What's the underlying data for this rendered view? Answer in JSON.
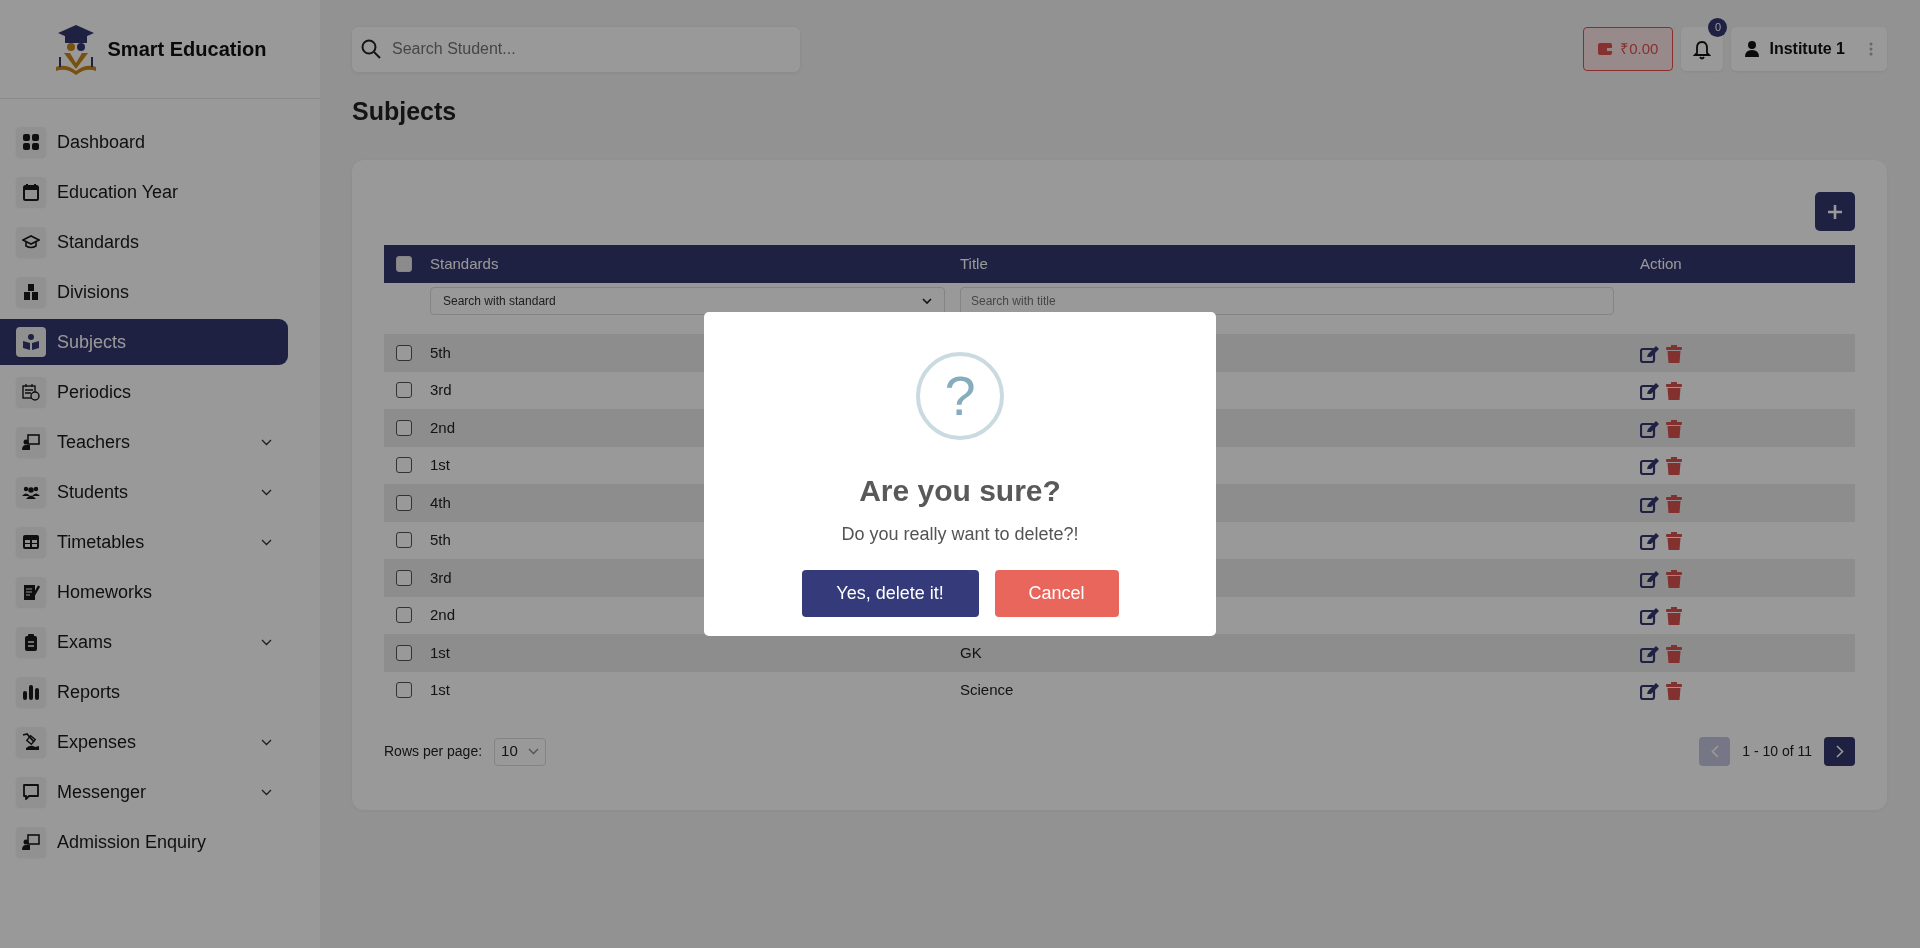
{
  "brand": {
    "name": "Smart Education"
  },
  "sidebar": {
    "items": [
      {
        "label": "Dashboard",
        "selected": false,
        "expandable": false
      },
      {
        "label": "Education Year",
        "selected": false,
        "expandable": false
      },
      {
        "label": "Standards",
        "selected": false,
        "expandable": false
      },
      {
        "label": "Divisions",
        "selected": false,
        "expandable": false
      },
      {
        "label": "Subjects",
        "selected": true,
        "expandable": false
      },
      {
        "label": "Periodics",
        "selected": false,
        "expandable": false
      },
      {
        "label": "Teachers",
        "selected": false,
        "expandable": true
      },
      {
        "label": "Students",
        "selected": false,
        "expandable": true
      },
      {
        "label": "Timetables",
        "selected": false,
        "expandable": true
      },
      {
        "label": "Homeworks",
        "selected": false,
        "expandable": false
      },
      {
        "label": "Exams",
        "selected": false,
        "expandable": true
      },
      {
        "label": "Reports",
        "selected": false,
        "expandable": false
      },
      {
        "label": "Expenses",
        "selected": false,
        "expandable": true
      },
      {
        "label": "Messenger",
        "selected": false,
        "expandable": true
      },
      {
        "label": "Admission Enquiry",
        "selected": false,
        "expandable": false
      }
    ]
  },
  "header": {
    "search": {
      "placeholder": "Search Student..."
    },
    "wallet": "₹0.00",
    "notifications": "0",
    "user": "Institute 1"
  },
  "page_title": "Subjects",
  "table": {
    "select_all": false,
    "columns": [
      "Standards",
      "Title",
      "Action"
    ],
    "filters": {
      "standard": "Search with standard",
      "title_placeholder": "Search with title"
    },
    "rows": [
      {
        "standard": "5th",
        "selected": false
      },
      {
        "standard": "3rd",
        "selected": false
      },
      {
        "standard": "2nd",
        "selected": false
      },
      {
        "standard": "1st",
        "selected": false
      },
      {
        "standard": "4th",
        "selected": false
      },
      {
        "standard": "5th",
        "selected": false
      },
      {
        "standard": "3rd",
        "selected": false
      },
      {
        "standard": "2nd",
        "selected": false
      },
      {
        "standard": "1st",
        "title": "GK",
        "selected": false
      },
      {
        "standard": "1st",
        "title": "Science",
        "selected": false
      }
    ]
  },
  "pagination": {
    "rows_per_page_label": "Rows per page:",
    "rows_per_page": "10",
    "range": "1 - 10 of 11",
    "prev_disabled": true,
    "next_disabled": false
  },
  "dialog": {
    "icon": "?",
    "title": "Are you sure?",
    "message": "Do you really want to delete?!",
    "confirm": "Yes, delete it!",
    "cancel": "Cancel"
  }
}
